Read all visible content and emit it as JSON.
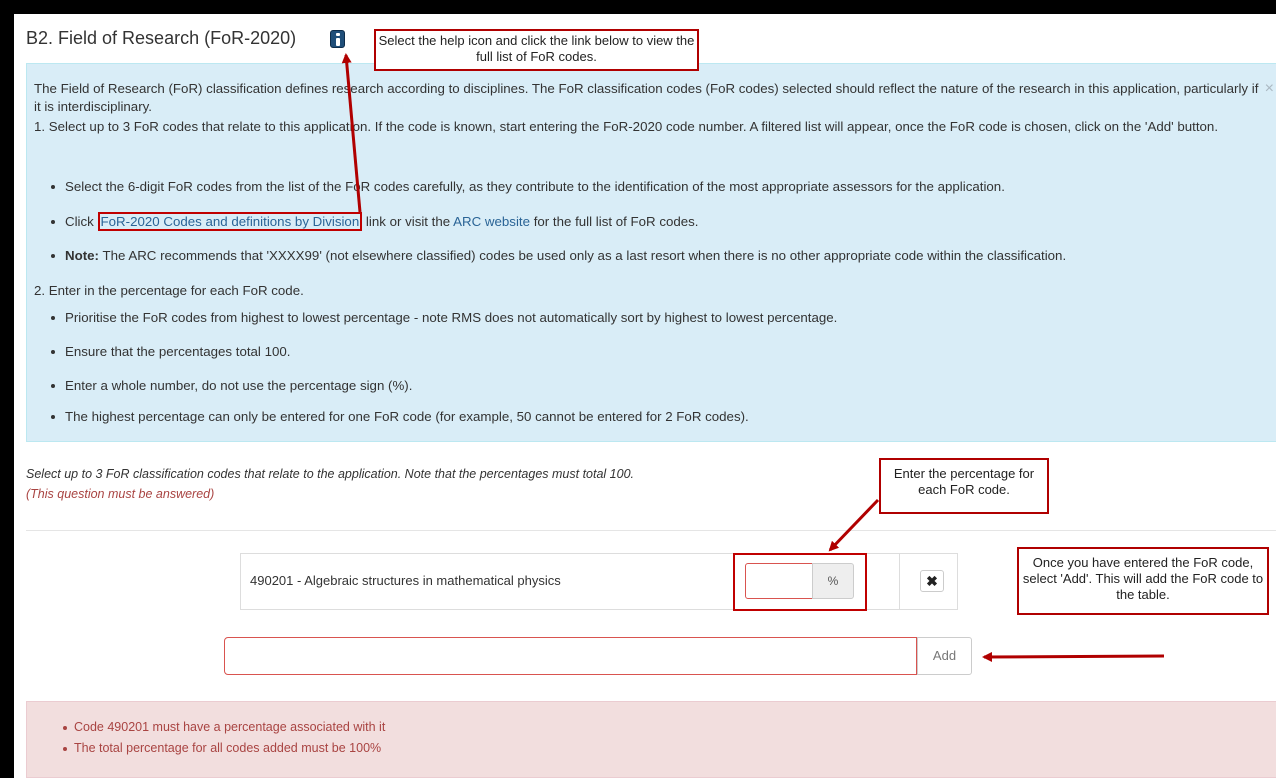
{
  "section": {
    "title": "B2. Field of Research (FoR-2020)"
  },
  "info": {
    "intro": "The Field of Research (FoR) classification defines research according to disciplines. The FoR classification codes (FoR codes) selected should reflect the nature of the research in this application, particularly if it is interdisciplinary.",
    "step1": "1. Select up to 3 FoR codes that relate to this application. If the code is known, start entering the FoR-2020 code number. A filtered list will appear, once the FoR code is chosen, click on the 'Add' button.",
    "step1_bullet1": "Select the 6-digit FoR codes from the list of the FoR codes carefully, as they contribute to the identification of the most appropriate assessors for the application.",
    "step1_bullet2_prefix": "Click",
    "step1_bullet2_link1": "FoR-2020 Codes and definitions by Division",
    "step1_bullet2_mid": "link or visit the",
    "step1_bullet2_link2": "ARC website",
    "step1_bullet2_suffix": "for the full list of FoR codes.",
    "step1_bullet3_bold": "Note:",
    "step1_bullet3_text": "The ARC recommends that 'XXXX99' (not elsewhere classified) codes be used only as a last resort when there is no other appropriate code within the classification.",
    "step2": "2. Enter in the percentage for each FoR code.",
    "step2_bullets": [
      "Prioritise the FoR codes from highest to lowest percentage - note RMS does not automatically sort by highest to lowest percentage.",
      "Ensure that the percentages total 100.",
      "Enter a whole number, do not use the percentage sign (%).",
      "The highest percentage can only be entered for one FoR code (for example, 50 cannot be entered for 2 FoR codes)."
    ],
    "close": "×"
  },
  "question": {
    "instruction": "Select up to 3 FoR classification codes that relate to the application. Note that the percentages must total 100.",
    "required": "(This question must be answered)"
  },
  "table": {
    "rows": [
      {
        "code_label": "490201 - Algebraic structures in mathematical physics",
        "percentage": "",
        "addon": "%",
        "remove": "✖"
      }
    ]
  },
  "add_row": {
    "input_value": "",
    "add_label": "Add"
  },
  "errors": [
    "Code 490201 must have a percentage associated with it",
    "The total percentage for all codes added must be 100%"
  ],
  "callouts": {
    "help": "Select the help icon and click the link below to view the full list of FoR codes.",
    "percentage": "Enter the percentage for each FoR code.",
    "add": "Once you have entered the FoR code, select 'Add'. This will add the FoR code to the table."
  },
  "colors": {
    "info_bg": "#d9edf7",
    "error_bg": "#f2dede",
    "callout_border": "#b00000",
    "link": "#2a6496"
  }
}
